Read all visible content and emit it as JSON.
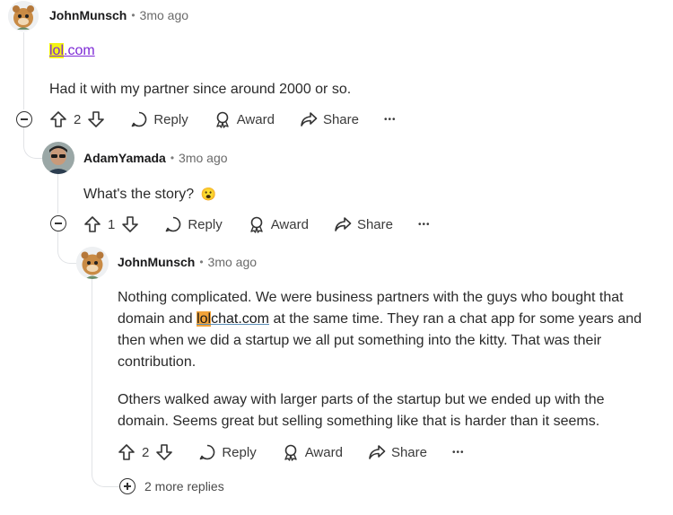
{
  "comments": [
    {
      "author": "JohnMunsch",
      "separator": "•",
      "time": "3mo ago",
      "link_highlight": "lol",
      "link_rest": ".com",
      "text": "Had it with my partner since around 2000 or so.",
      "votes": "2",
      "reply_label": "Reply",
      "award_label": "Award",
      "share_label": "Share",
      "more_label": "•••"
    },
    {
      "author": "AdamYamada",
      "separator": "•",
      "time": "3mo ago",
      "text": "What's the story?",
      "emoji": "😮",
      "votes": "1",
      "reply_label": "Reply",
      "award_label": "Award",
      "share_label": "Share",
      "more_label": "•••"
    },
    {
      "author": "JohnMunsch",
      "separator": "•",
      "time": "3mo ago",
      "p1_a": "Nothing complicated. We were business partners with the guys who bought that domain and ",
      "p1_link_highlight": "lol",
      "p1_link_rest": "chat.com",
      "p1_b": " at the same time. They ran a chat app for some years and then when we did a startup we all put something into the kitty. That was their contribution.",
      "p2": "Others walked away with larger parts of the startup but we ended up with the domain. Seems great but selling something like that is harder than it seems.",
      "votes": "2",
      "reply_label": "Reply",
      "award_label": "Award",
      "share_label": "Share",
      "more_label": "•••"
    }
  ],
  "more_replies_label": "2 more replies"
}
